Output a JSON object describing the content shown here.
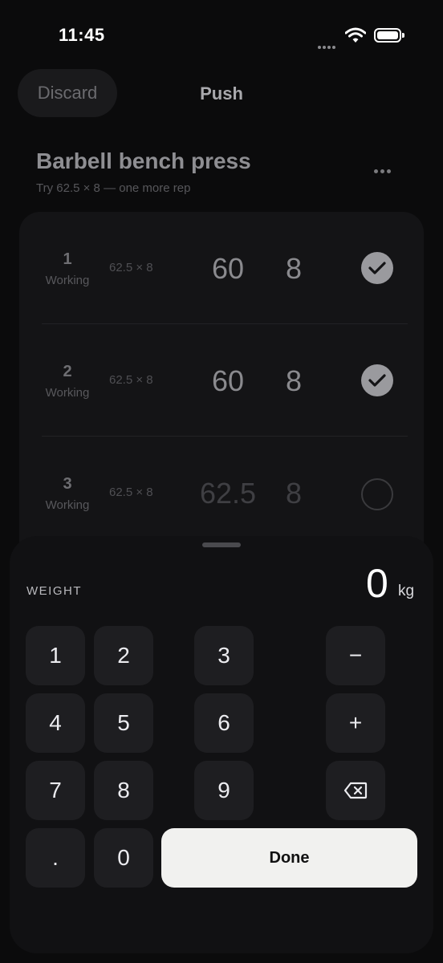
{
  "status_bar": {
    "time": "11:45"
  },
  "header": {
    "discard_label": "Discard",
    "title": "Push"
  },
  "exercise": {
    "name": "Barbell bench press",
    "hint": "Try 62.5 × 8 — one more rep"
  },
  "sets": [
    {
      "number": "1",
      "type": "Working",
      "previous": "62.5 × 8",
      "weight": "60",
      "reps": "8",
      "completed": true
    },
    {
      "number": "2",
      "type": "Working",
      "previous": "62.5 × 8",
      "weight": "60",
      "reps": "8",
      "completed": true
    },
    {
      "number": "3",
      "type": "Working",
      "previous": "62.5 × 8",
      "weight": "62.5",
      "reps": "8",
      "completed": false
    }
  ],
  "keypad": {
    "field_label": "WEIGHT",
    "value": "0",
    "unit": "kg",
    "keys": {
      "k1": "1",
      "k2": "2",
      "k3": "3",
      "k4": "4",
      "k5": "5",
      "k6": "6",
      "k7": "7",
      "k8": "8",
      "k9": "9",
      "kdot": ".",
      "k0": "0",
      "minus": "−",
      "plus": "+"
    },
    "done_label": "Done"
  }
}
